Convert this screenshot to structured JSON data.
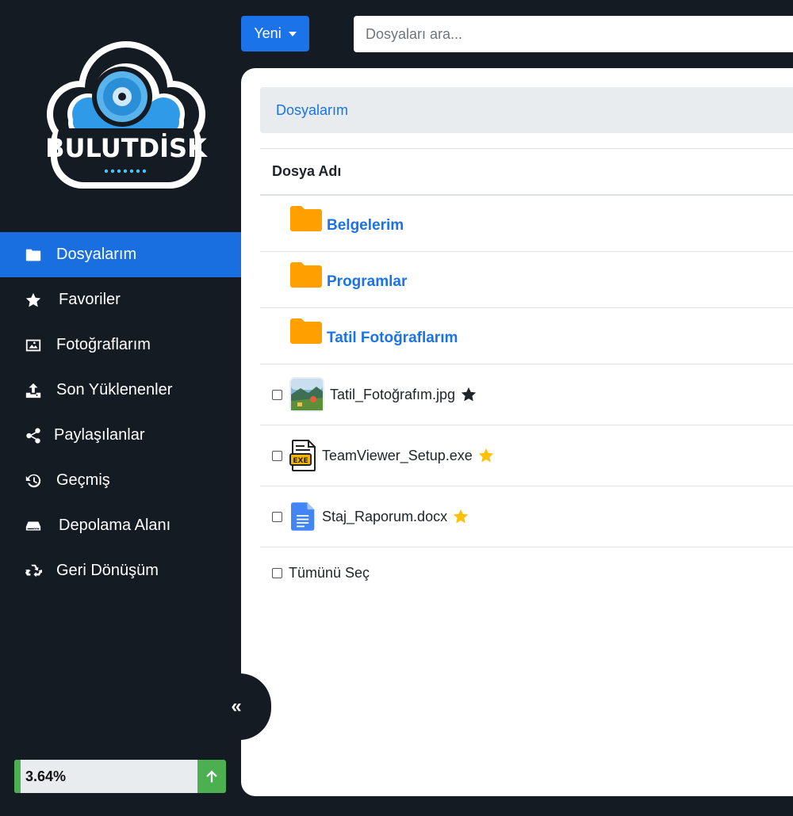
{
  "brand": {
    "logo_text": "BULUTDİSK"
  },
  "sidebar": {
    "items": [
      {
        "label": "Dosyalarım",
        "icon": "folder-icon",
        "active": true
      },
      {
        "label": "Favoriler",
        "icon": "star-icon"
      },
      {
        "label": "Fotoğraflarım",
        "icon": "image-icon"
      },
      {
        "label": "Son Yüklenenler",
        "icon": "upload-icon"
      },
      {
        "label": "Paylaşılanlar",
        "icon": "share-icon"
      },
      {
        "label": "Geçmiş",
        "icon": "history-icon"
      },
      {
        "label": "Depolama Alanı",
        "icon": "hdd-icon"
      },
      {
        "label": "Geri Dönüşüm",
        "icon": "recycle-icon"
      }
    ],
    "collapse_label": "«",
    "storage": {
      "percent_label": "3.64%",
      "percent": 3.64
    }
  },
  "toolbar": {
    "new_label": "Yeni"
  },
  "search": {
    "placeholder": "Dosyaları ara..."
  },
  "breadcrumb": {
    "current": "Dosyalarım"
  },
  "table": {
    "header": "Dosya Adı",
    "folders": [
      {
        "name": "Belgelerim"
      },
      {
        "name": "Programlar"
      },
      {
        "name": "Tatil Fotoğraflarım"
      }
    ],
    "files": [
      {
        "name": "Tatil_Fotoğrafım.jpg",
        "type": "image",
        "favorite": false
      },
      {
        "name": "TeamViewer_Setup.exe",
        "type": "exe",
        "favorite": true
      },
      {
        "name": "Staj_Raporum.docx",
        "type": "docx",
        "favorite": true
      }
    ],
    "select_all_label": "Tümünü Seç"
  },
  "colors": {
    "accent": "#1a73e8",
    "sidebar_bg": "#141b23",
    "folder": "#ffa000",
    "star_fav": "#ffc107",
    "storage": "#4caf50"
  }
}
